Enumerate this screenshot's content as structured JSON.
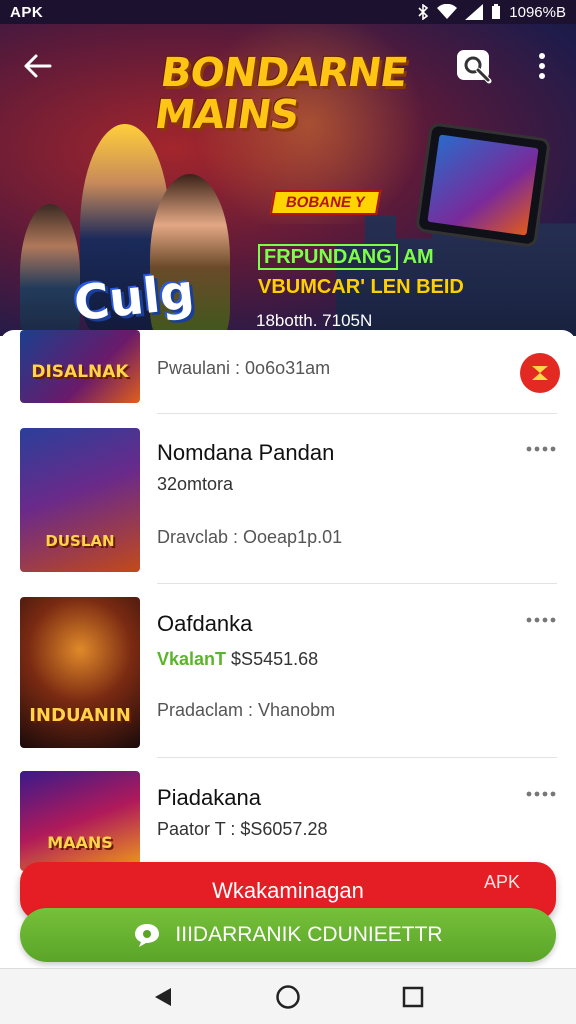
{
  "status_bar": {
    "left_label": "APK",
    "battery_text": "1096%B"
  },
  "hero": {
    "title": "BONDARNE MAINS",
    "badge": "BOBANE Y",
    "tag_boxed": "FRPUNDANG",
    "tag_rest": "AM",
    "subtitle": "VBUMCAR' LEN BEID",
    "stats": "18botth. 7105N",
    "logo": "Culg"
  },
  "list": {
    "partial_item": {
      "thumb_label": "DISALNAK",
      "detail": "Pwaulani : 0o6o31am"
    },
    "items": [
      {
        "thumb_label": "DUSLAN",
        "name": "Nomdana Pandan",
        "line2": "32omtora",
        "line3": "Dravclab : Ooeap1p.01"
      },
      {
        "thumb_label": "INDUANIN",
        "name": "Oafdanka",
        "line2_highlight": "VkalanT",
        "line2_value": "$S5451.68",
        "line3": "Pradaclam : Vhanobm"
      },
      {
        "thumb_label": "MAANS",
        "name": "Piadakana",
        "line2": "Paator T : $S6057.28"
      }
    ]
  },
  "cta": {
    "primary_label": "Wkakaminagan",
    "primary_badge": "APK",
    "secondary_label": "IIIDARRANIK CDUNIEETTR"
  },
  "colors": {
    "accent_red": "#e41e24",
    "accent_green": "#5aa528",
    "hero_title": "#ffc515"
  }
}
